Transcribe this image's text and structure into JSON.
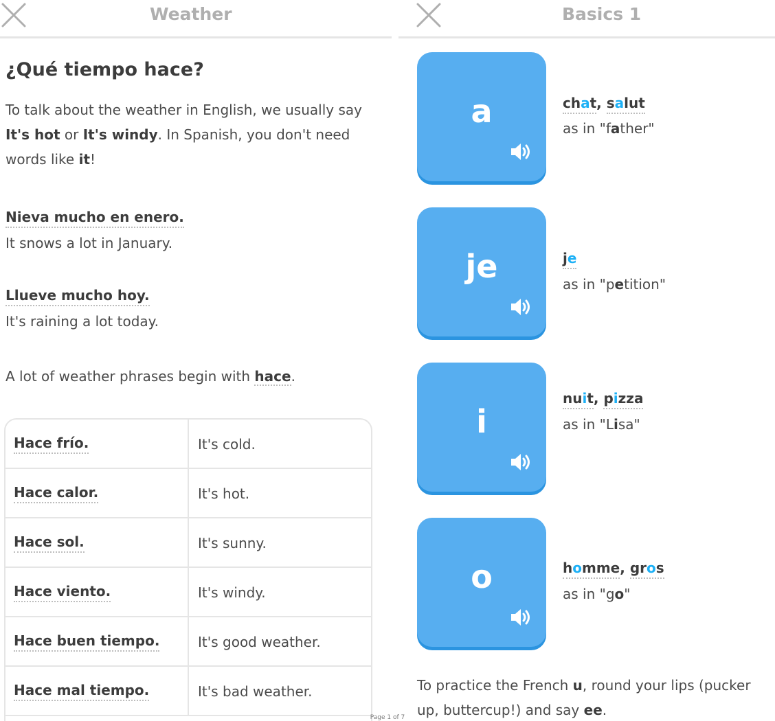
{
  "left": {
    "header": {
      "title": "Weather"
    },
    "heading": "¿Qué tiempo hace?",
    "intro": {
      "p1": "To talk about the weather in English, we usually say ",
      "b1": "It's hot",
      "p2": " or ",
      "b2": "It's windy",
      "p3": ". In Spanish, you don't need words like ",
      "b3": "it",
      "p4": "!"
    },
    "examples": [
      {
        "spanish": "Nieva mucho en enero.",
        "english": "It snows a lot in January."
      },
      {
        "spanish": "Llueve mucho hoy.",
        "english": "It's raining a lot today."
      }
    ],
    "phrase_note": {
      "text": "A lot of weather phrases begin with ",
      "word": "hace",
      "end": "."
    },
    "table": [
      {
        "spanish": "Hace frío.",
        "english": "It's cold."
      },
      {
        "spanish": "Hace calor.",
        "english": "It's hot."
      },
      {
        "spanish": "Hace sol.",
        "english": "It's sunny."
      },
      {
        "spanish": "Hace viento.",
        "english": "It's windy."
      },
      {
        "spanish": "Hace buen tiempo.",
        "english": "It's good weather."
      },
      {
        "spanish": "Hace mal tiempo.",
        "english": "It's bad weather."
      }
    ]
  },
  "right": {
    "header": {
      "title": "Basics 1"
    },
    "sounds": [
      {
        "letter": "a",
        "w1": [
          {
            "t": "ch"
          },
          {
            "t": "a",
            "hl": true
          },
          {
            "t": "t"
          }
        ],
        "w2": [
          {
            "t": "s"
          },
          {
            "t": "a",
            "hl": true
          },
          {
            "t": "lut"
          }
        ],
        "as_in": "as in \"",
        "d1": "f",
        "d2": "a",
        "d3": "ther\""
      },
      {
        "letter": "je",
        "w1": [
          {
            "t": "j"
          },
          {
            "t": "e",
            "hl": true
          }
        ],
        "w2": null,
        "as_in": "as in \"",
        "d1": "p",
        "d2": "e",
        "d3": "tition\""
      },
      {
        "letter": "i",
        "w1": [
          {
            "t": "nu"
          },
          {
            "t": "i",
            "hl": true
          },
          {
            "t": "t"
          }
        ],
        "w2": [
          {
            "t": "p"
          },
          {
            "t": "i",
            "hl": true
          },
          {
            "t": "zza"
          }
        ],
        "as_in": "as in \"",
        "d1": "L",
        "d2": "i",
        "d3": "sa\""
      },
      {
        "letter": "o",
        "w1": [
          {
            "t": "h"
          },
          {
            "t": "o",
            "hl": true
          },
          {
            "t": "mme"
          }
        ],
        "w2": [
          {
            "t": "gr"
          },
          {
            "t": "o",
            "hl": true
          },
          {
            "t": "s"
          }
        ],
        "as_in": "as in \"",
        "d1": "g",
        "d2": "o",
        "d3": "\""
      }
    ],
    "tip": {
      "p1": "To practice the French ",
      "b1": "u",
      "p2": ", round your lips (pucker up, buttercup!) and say ",
      "b2": "ee",
      "p3": "."
    }
  },
  "footer_caption": "Page 1 of 7",
  "icons": {
    "close": "close-icon",
    "speaker": "speaker-icon"
  },
  "colors": {
    "card": "#57aef0",
    "highlight": "#1cb0f6",
    "header_title": "#afafaf"
  }
}
